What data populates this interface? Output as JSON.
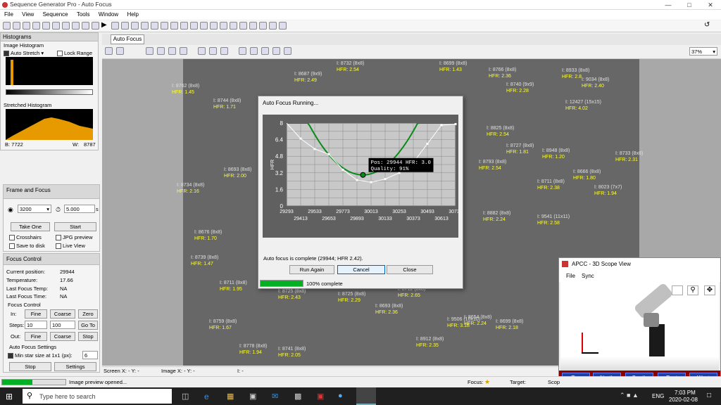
{
  "app": {
    "title": "Sequence Generator Pro - Auto Focus"
  },
  "menu": [
    "File",
    "View",
    "Sequence",
    "Tools",
    "Window",
    "Help"
  ],
  "histograms": {
    "title": "Histograms",
    "image_hist": "Image Histogram",
    "auto_stretch": "Auto Stretch",
    "lock_range": "Lock Range",
    "stretched": "Stretched Histogram",
    "b_label": "B: 7722",
    "w_label": "W:",
    "w_value": "8787"
  },
  "frame": {
    "title": "Frame and Focus",
    "binning": "3200",
    "exposure": "5.000",
    "exp_unit": "s",
    "take_one": "Take One",
    "start": "Start",
    "crosshairs": "Crosshairs",
    "jpg": "JPG preview",
    "save": "Save to disk",
    "live": "Live View"
  },
  "focus": {
    "title": "Focus Control",
    "pos_label": "Current position:",
    "pos": "29944",
    "temp_label": "Temperature:",
    "temp": "17.66",
    "lft_label": "Last Focus Temp:",
    "lft": "NA",
    "lftime_label": "Last Focus Time:",
    "lftime": "NA",
    "fc_label": "Focus Control",
    "in": "In:",
    "fine": "Fine",
    "coarse": "Coarse",
    "zero": "Zero",
    "steps": "Steps:",
    "s1": "10",
    "s2": "100",
    "goto": "Go To",
    "out": "Out:",
    "stop": "Stop",
    "af_label": "Auto Focus Settings",
    "min_star": "Min star size at 1x1 (px):",
    "min_val": "6",
    "stop_btn": "Stop",
    "settings": "Settings"
  },
  "doc": {
    "tab": "Auto Focus",
    "zoom": "37%"
  },
  "stars": [
    {
      "n": "I: 8762 (8x8)",
      "h": "HFR: 1.45"
    },
    {
      "n": "I: 8744 (8x8)",
      "h": "HFR: 1.71"
    },
    {
      "n": "I: 8687 (9x9)",
      "h": "HFR: 2.49"
    },
    {
      "n": "I: 8732 (8x8)",
      "h": "HFR: 2.54"
    },
    {
      "n": "I: 8699 (8x8)",
      "h": "HFR: 1.43"
    },
    {
      "n": "I: 8766 (8x8)",
      "h": "HFR: 2.36"
    },
    {
      "n": "I: 8740 (9x9)",
      "h": "HFR: 2.28"
    },
    {
      "n": "I: 8933 (8x8)",
      "h": "HFR: 2.8"
    },
    {
      "n": "I: 9034 (8x8)",
      "h": "HFR: 2.40"
    },
    {
      "n": "I: 12427 (15x15)",
      "h": "HFR: 4.02"
    },
    {
      "n": "I: 8825 (8x8)",
      "h": "HFR: 2.54"
    },
    {
      "n": "I: 8727 (8x8)",
      "h": "HFR: 1.81"
    },
    {
      "n": "I: 8948 (8x8)",
      "h": "HFR: 1.20"
    },
    {
      "n": "I: 8733 (8x8)",
      "h": "HFR: 2.31"
    },
    {
      "n": "I: 8793 (8x8)",
      "h": "HFR: 2.54"
    },
    {
      "n": "I: 8666 (8x8)",
      "h": "HFR: 1.80"
    },
    {
      "n": "I: 8711 (8x8)",
      "h": "HFR: 2.38"
    },
    {
      "n": "I: 8023 (7x7)",
      "h": "HFR: 1.94"
    },
    {
      "n": "I: 8693 (8x8)",
      "h": "HFR: 2.00"
    },
    {
      "n": "I: 8734 (8x8)",
      "h": "HFR: 2.16"
    },
    {
      "n": "I: 8882 (8x8)",
      "h": "HFR: 2.24"
    },
    {
      "n": "I: 9541 (11x11)",
      "h": "HFR: 2.58"
    },
    {
      "n": "I: 8676 (8x8)",
      "h": "HFR: 1.70"
    },
    {
      "n": "I: 8739 (8x8)",
      "h": "HFR: 1.47"
    },
    {
      "n": "I: 8711 (8x8)",
      "h": "HFR: 1.95"
    },
    {
      "n": "I: 8725 (8x8)",
      "h": "HFR: 2.43"
    },
    {
      "n": "I: 8725 (8x8)",
      "h": "HFR: 2.29"
    },
    {
      "n": "I: 8712 (8x8)",
      "h": "HFR: 2.65"
    },
    {
      "n": "I: 8693 (8x8)",
      "h": "HFR: 2.36"
    },
    {
      "n": "I: 9506 (10x10)",
      "h": "HFR: 3.18"
    },
    {
      "n": "I: 8699 (8x8)",
      "h": "HFR: 2.18"
    },
    {
      "n": "I: 8759 (8x8)",
      "h": "HFR: 1.67"
    },
    {
      "n": "I: 8778 (8x8)",
      "h": "HFR: 1.94"
    },
    {
      "n": "I: 8741 (8x8)",
      "h": "HFR: 2.05"
    },
    {
      "n": "I: 8912 (8x8)",
      "h": "HFR: 2.35"
    },
    {
      "n": "I: 8654 (8x8)",
      "h": "HFR: 2.24"
    }
  ],
  "dialog": {
    "title": "Auto Focus Running...",
    "status": "Auto focus is complete (29944; HFR 2.42).",
    "run_again": "Run Again",
    "cancel": "Cancel",
    "close": "Close",
    "progress": 1.0,
    "progress_text": "100% complete"
  },
  "chart_data": {
    "type": "line",
    "ylabel": "HFR",
    "ylim": [
      0,
      8
    ],
    "yticks": [
      "8",
      "6.4",
      "4.8",
      "3.2",
      "1.6",
      "0"
    ],
    "xticks_top": [
      "29293",
      "29533",
      "29773",
      "30013",
      "30253",
      "30493",
      "30733"
    ],
    "xticks_bottom": [
      "29413",
      "29653",
      "29893",
      "30133",
      "30373",
      "30613"
    ],
    "xlim": [
      29293,
      30733
    ],
    "series": [
      {
        "x": [
          29293,
          29413,
          29533,
          29653,
          29773,
          29893,
          30013,
          30133,
          30253,
          30373,
          30493,
          30613,
          30733
        ],
        "y": [
          9.2,
          6.5,
          5.5,
          5.0,
          3.5,
          2.5,
          2.3,
          2.6,
          3.2,
          4.2,
          6.0,
          7.8,
          7.9
        ]
      }
    ],
    "fit_vertex": [
      29944,
      3.0
    ],
    "fit_a": 2.3e-05,
    "annotation": [
      "Pos: 29944 HFR: 3.0",
      "Quality: 91%"
    ]
  },
  "scope": {
    "title": "APCC - 3D Scope View",
    "menu": [
      "File",
      "Sync"
    ],
    "buttons": [
      "Top",
      "North",
      "South",
      "East",
      "West"
    ]
  },
  "status": {
    "screen": "Screen X: - Y: -",
    "image": "Image X: - Y: -",
    "i": "I: -",
    "preview": "Image preview opened...",
    "focus": "Focus:",
    "target": "Target:",
    "scope": "Scop"
  },
  "taskbar": {
    "search": "Type here to search",
    "lang": "ENG",
    "time": "7:03 PM",
    "date": "2020-02-08"
  }
}
